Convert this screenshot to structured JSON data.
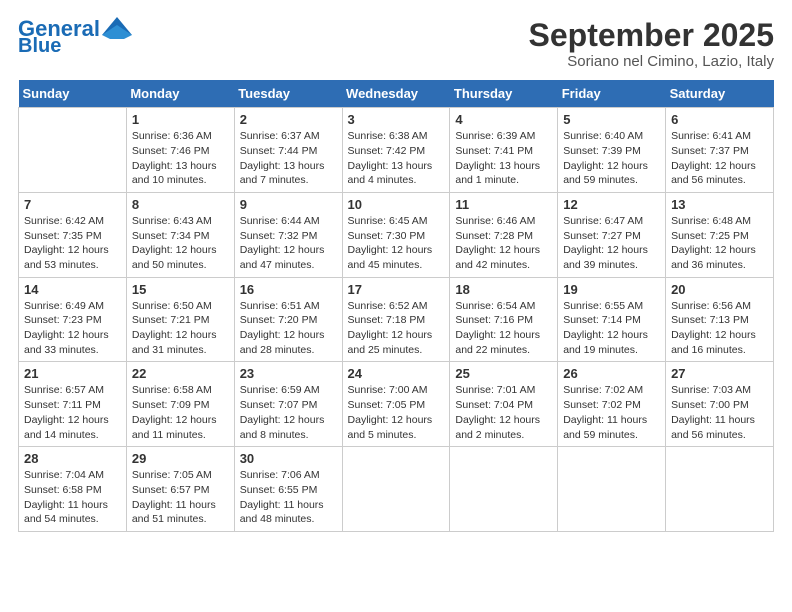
{
  "header": {
    "logo_line1": "General",
    "logo_line2": "Blue",
    "month": "September 2025",
    "location": "Soriano nel Cimino, Lazio, Italy"
  },
  "days_of_week": [
    "Sunday",
    "Monday",
    "Tuesday",
    "Wednesday",
    "Thursday",
    "Friday",
    "Saturday"
  ],
  "weeks": [
    [
      {
        "day": "",
        "info": ""
      },
      {
        "day": "1",
        "info": "Sunrise: 6:36 AM\nSunset: 7:46 PM\nDaylight: 13 hours\nand 10 minutes."
      },
      {
        "day": "2",
        "info": "Sunrise: 6:37 AM\nSunset: 7:44 PM\nDaylight: 13 hours\nand 7 minutes."
      },
      {
        "day": "3",
        "info": "Sunrise: 6:38 AM\nSunset: 7:42 PM\nDaylight: 13 hours\nand 4 minutes."
      },
      {
        "day": "4",
        "info": "Sunrise: 6:39 AM\nSunset: 7:41 PM\nDaylight: 13 hours\nand 1 minute."
      },
      {
        "day": "5",
        "info": "Sunrise: 6:40 AM\nSunset: 7:39 PM\nDaylight: 12 hours\nand 59 minutes."
      },
      {
        "day": "6",
        "info": "Sunrise: 6:41 AM\nSunset: 7:37 PM\nDaylight: 12 hours\nand 56 minutes."
      }
    ],
    [
      {
        "day": "7",
        "info": "Sunrise: 6:42 AM\nSunset: 7:35 PM\nDaylight: 12 hours\nand 53 minutes."
      },
      {
        "day": "8",
        "info": "Sunrise: 6:43 AM\nSunset: 7:34 PM\nDaylight: 12 hours\nand 50 minutes."
      },
      {
        "day": "9",
        "info": "Sunrise: 6:44 AM\nSunset: 7:32 PM\nDaylight: 12 hours\nand 47 minutes."
      },
      {
        "day": "10",
        "info": "Sunrise: 6:45 AM\nSunset: 7:30 PM\nDaylight: 12 hours\nand 45 minutes."
      },
      {
        "day": "11",
        "info": "Sunrise: 6:46 AM\nSunset: 7:28 PM\nDaylight: 12 hours\nand 42 minutes."
      },
      {
        "day": "12",
        "info": "Sunrise: 6:47 AM\nSunset: 7:27 PM\nDaylight: 12 hours\nand 39 minutes."
      },
      {
        "day": "13",
        "info": "Sunrise: 6:48 AM\nSunset: 7:25 PM\nDaylight: 12 hours\nand 36 minutes."
      }
    ],
    [
      {
        "day": "14",
        "info": "Sunrise: 6:49 AM\nSunset: 7:23 PM\nDaylight: 12 hours\nand 33 minutes."
      },
      {
        "day": "15",
        "info": "Sunrise: 6:50 AM\nSunset: 7:21 PM\nDaylight: 12 hours\nand 31 minutes."
      },
      {
        "day": "16",
        "info": "Sunrise: 6:51 AM\nSunset: 7:20 PM\nDaylight: 12 hours\nand 28 minutes."
      },
      {
        "day": "17",
        "info": "Sunrise: 6:52 AM\nSunset: 7:18 PM\nDaylight: 12 hours\nand 25 minutes."
      },
      {
        "day": "18",
        "info": "Sunrise: 6:54 AM\nSunset: 7:16 PM\nDaylight: 12 hours\nand 22 minutes."
      },
      {
        "day": "19",
        "info": "Sunrise: 6:55 AM\nSunset: 7:14 PM\nDaylight: 12 hours\nand 19 minutes."
      },
      {
        "day": "20",
        "info": "Sunrise: 6:56 AM\nSunset: 7:13 PM\nDaylight: 12 hours\nand 16 minutes."
      }
    ],
    [
      {
        "day": "21",
        "info": "Sunrise: 6:57 AM\nSunset: 7:11 PM\nDaylight: 12 hours\nand 14 minutes."
      },
      {
        "day": "22",
        "info": "Sunrise: 6:58 AM\nSunset: 7:09 PM\nDaylight: 12 hours\nand 11 minutes."
      },
      {
        "day": "23",
        "info": "Sunrise: 6:59 AM\nSunset: 7:07 PM\nDaylight: 12 hours\nand 8 minutes."
      },
      {
        "day": "24",
        "info": "Sunrise: 7:00 AM\nSunset: 7:05 PM\nDaylight: 12 hours\nand 5 minutes."
      },
      {
        "day": "25",
        "info": "Sunrise: 7:01 AM\nSunset: 7:04 PM\nDaylight: 12 hours\nand 2 minutes."
      },
      {
        "day": "26",
        "info": "Sunrise: 7:02 AM\nSunset: 7:02 PM\nDaylight: 11 hours\nand 59 minutes."
      },
      {
        "day": "27",
        "info": "Sunrise: 7:03 AM\nSunset: 7:00 PM\nDaylight: 11 hours\nand 56 minutes."
      }
    ],
    [
      {
        "day": "28",
        "info": "Sunrise: 7:04 AM\nSunset: 6:58 PM\nDaylight: 11 hours\nand 54 minutes."
      },
      {
        "day": "29",
        "info": "Sunrise: 7:05 AM\nSunset: 6:57 PM\nDaylight: 11 hours\nand 51 minutes."
      },
      {
        "day": "30",
        "info": "Sunrise: 7:06 AM\nSunset: 6:55 PM\nDaylight: 11 hours\nand 48 minutes."
      },
      {
        "day": "",
        "info": ""
      },
      {
        "day": "",
        "info": ""
      },
      {
        "day": "",
        "info": ""
      },
      {
        "day": "",
        "info": ""
      }
    ]
  ]
}
